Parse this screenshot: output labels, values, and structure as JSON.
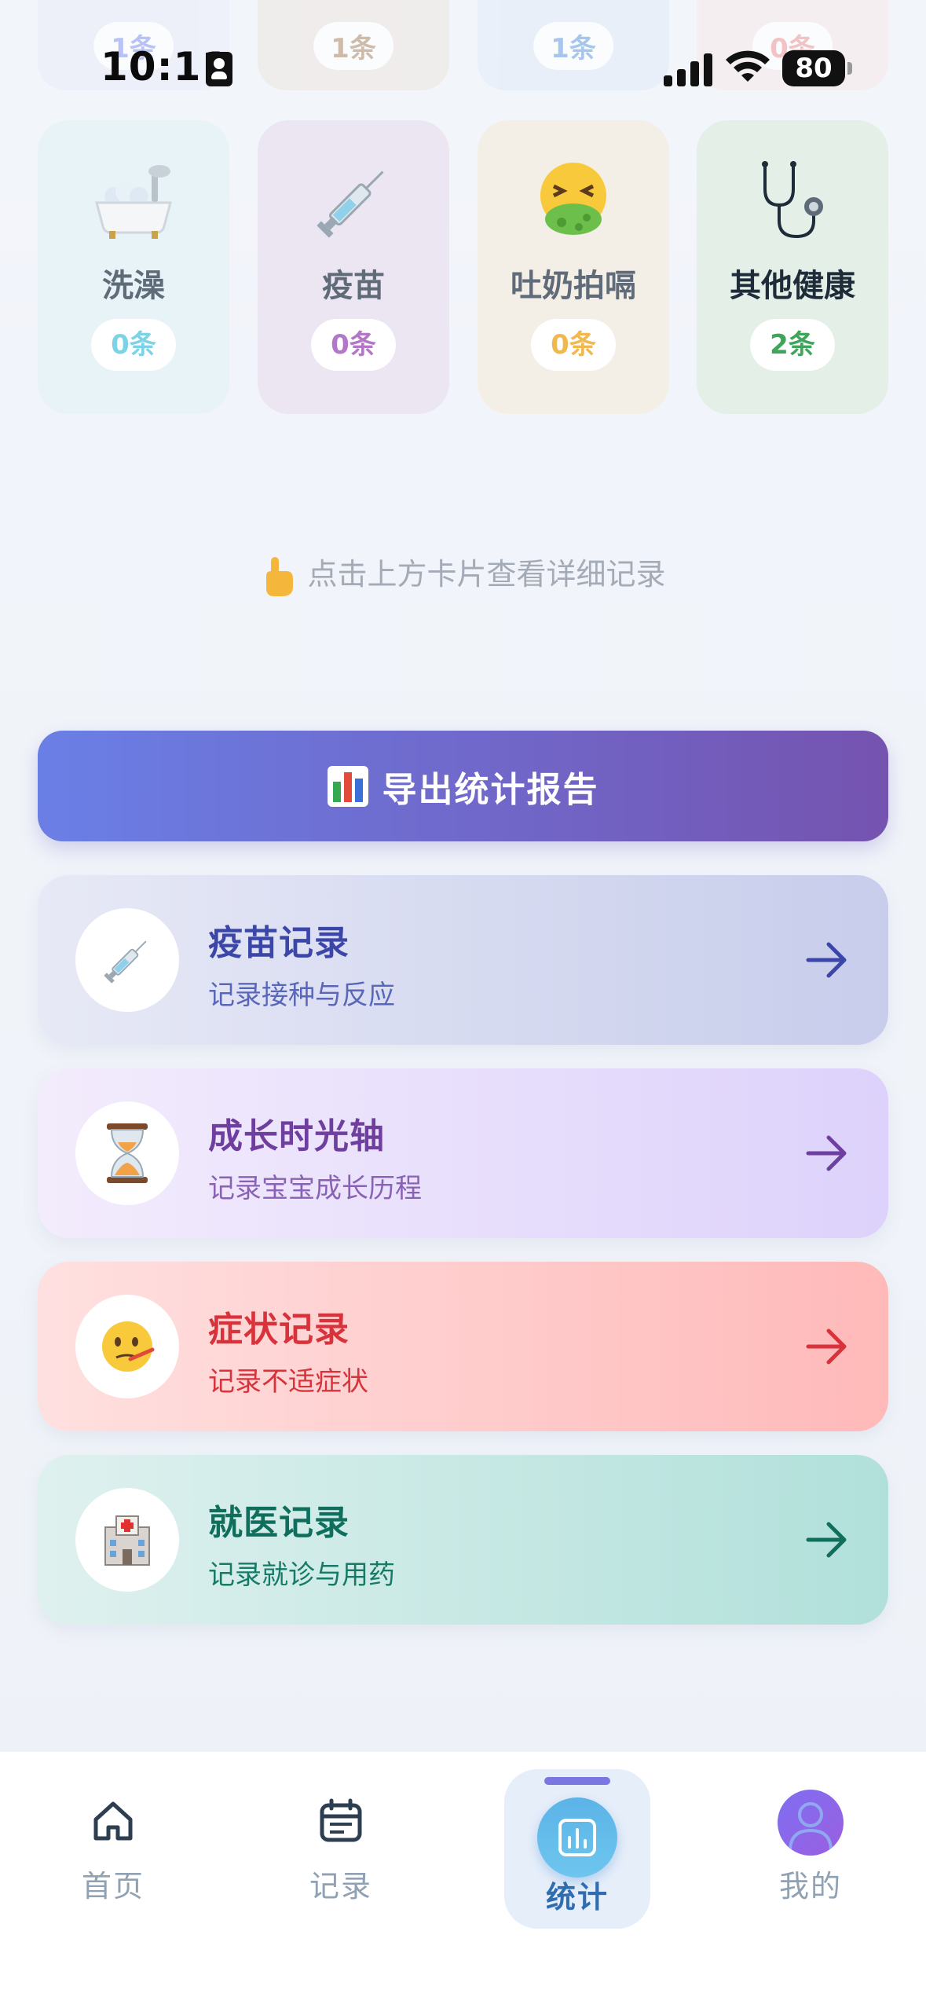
{
  "status_bar": {
    "time": "10:11",
    "battery": "80"
  },
  "top_partial_cards": [
    {
      "count": "1条",
      "color": "#a7b1f5",
      "bg": "#ecedf9"
    },
    {
      "count": "1条",
      "color": "#c3a88e",
      "bg": "#eeeae7"
    },
    {
      "count": "1条",
      "color": "#8fb7ea",
      "bg": "#e6eef9"
    },
    {
      "count": "0条",
      "color": "#f3b2b4",
      "bg": "#f7ecee"
    }
  ],
  "categories": [
    {
      "name": "洗澡",
      "count": "0条",
      "icon": "bathtub-icon",
      "name_color": "#5f6b79",
      "count_color": "#7dd3e6",
      "bg": "#e8f3f8"
    },
    {
      "name": "疫苗",
      "count": "0条",
      "icon": "syringe-icon",
      "name_color": "#5f6b79",
      "count_color": "#b477c8",
      "bg": "#ebe6f2"
    },
    {
      "name": "吐奶拍嗝",
      "count": "0条",
      "icon": "vomit-face-icon",
      "name_color": "#5f6b79",
      "count_color": "#f1b84f",
      "bg": "#f4efe6"
    },
    {
      "name": "其他健康",
      "count": "2条",
      "icon": "stethoscope-icon",
      "name_color": "#1e2c3a",
      "count_color": "#3fa55a",
      "bg": "#e4efe8"
    }
  ],
  "hint": {
    "text": "点击上方卡片查看详细记录",
    "icon": "pointing-finger-icon"
  },
  "export_button": {
    "label": "导出统计报告",
    "icon": "bar-chart-icon"
  },
  "records": [
    {
      "title": "疫苗记录",
      "subtitle": "记录接种与反应",
      "icon": "syringe-icon",
      "title_color": "#3b46a8",
      "sub_color": "#5a67b8",
      "arrow_color": "#3b46a8",
      "bg": "linear-gradient(90deg,#e7e9f6,#c7cdeb)"
    },
    {
      "title": "成长时光轴",
      "subtitle": "记录宝宝成长历程",
      "icon": "hourglass-icon",
      "title_color": "#6e3f9e",
      "sub_color": "#8a62b5",
      "arrow_color": "#6e3f9e",
      "bg": "linear-gradient(90deg,#f3ecfc,#ddd2fb)"
    },
    {
      "title": "症状记录",
      "subtitle": "记录不适症状",
      "icon": "sick-face-icon",
      "title_color": "#d8323a",
      "sub_color": "#d8323a",
      "arrow_color": "#d8323a",
      "bg": "linear-gradient(90deg,#ffe0e0,#ffb9b9)"
    },
    {
      "title": "就医记录",
      "subtitle": "记录就诊与用药",
      "icon": "hospital-icon",
      "title_color": "#0f6e5c",
      "sub_color": "#177a66",
      "arrow_color": "#0f6e5c",
      "bg": "linear-gradient(90deg,#dff1ef,#b1e0da)"
    }
  ],
  "tabs": [
    {
      "label": "首页",
      "icon": "home-icon",
      "active": false
    },
    {
      "label": "记录",
      "icon": "calendar-icon",
      "active": false
    },
    {
      "label": "统计",
      "icon": "stats-icon",
      "active": true
    },
    {
      "label": "我的",
      "icon": "avatar-icon",
      "active": false
    }
  ]
}
